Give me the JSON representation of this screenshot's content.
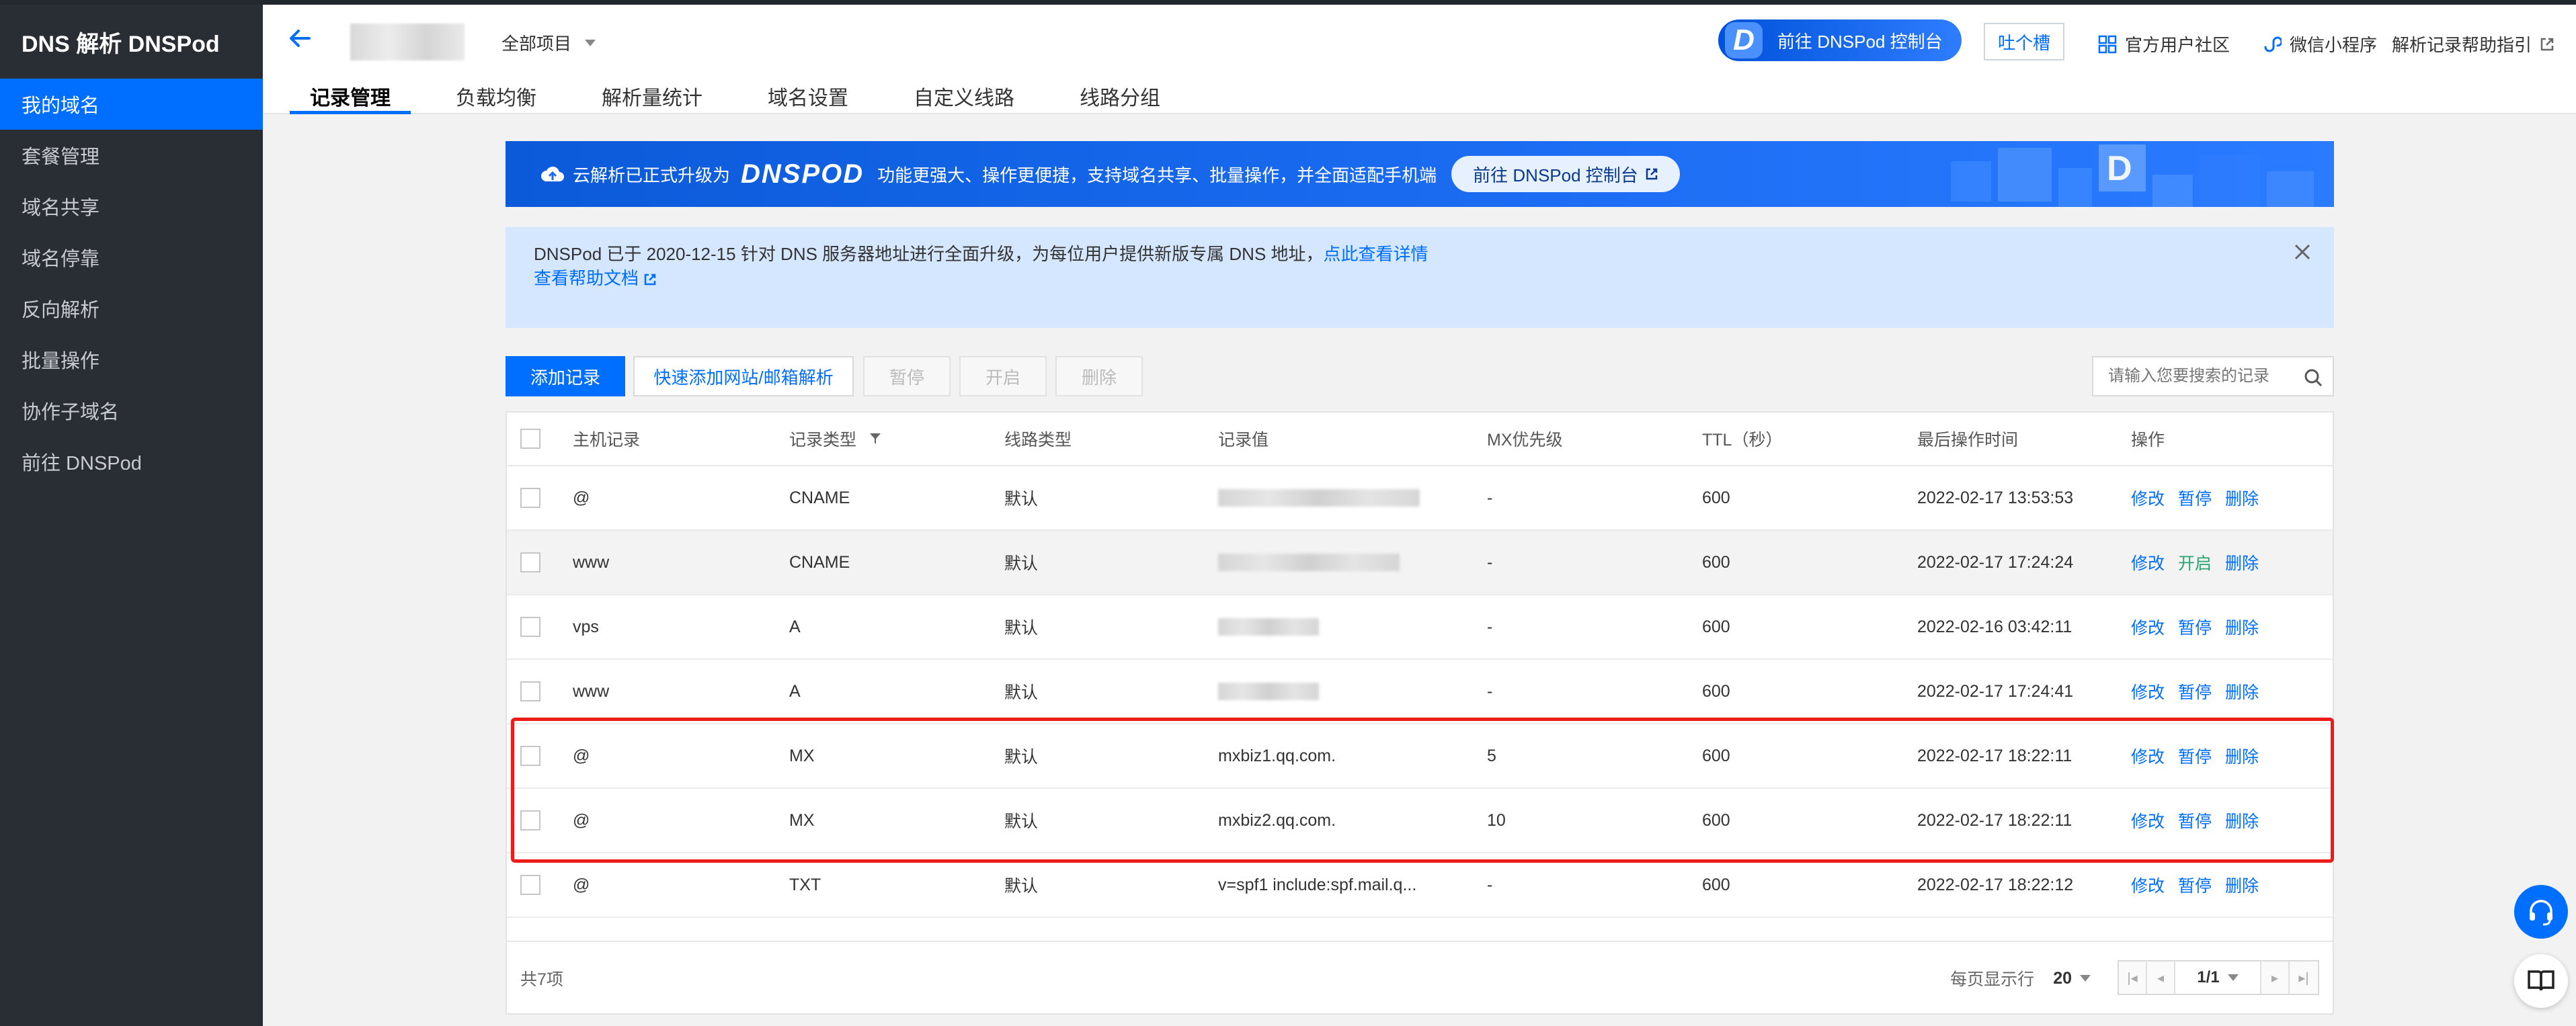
{
  "app": {
    "title": "DNS 解析 DNSPod"
  },
  "sidebar": {
    "items": [
      {
        "label": "我的域名",
        "active": true
      },
      {
        "label": "套餐管理"
      },
      {
        "label": "域名共享"
      },
      {
        "label": "域名停靠"
      },
      {
        "label": "反向解析"
      },
      {
        "label": "批量操作"
      },
      {
        "label": "协作子域名"
      },
      {
        "label": "前往 DNSPod"
      }
    ]
  },
  "header": {
    "project": "全部项目",
    "dnspod_button": "前往 DNSPod 控制台",
    "feedback": "吐个槽",
    "community": "官方用户社区",
    "miniprogram": "微信小程序",
    "help": "解析记录帮助指引",
    "tabs": [
      {
        "label": "记录管理",
        "active": true
      },
      {
        "label": "负载均衡"
      },
      {
        "label": "解析量统计"
      },
      {
        "label": "域名设置"
      },
      {
        "label": "自定义线路"
      },
      {
        "label": "线路分组"
      }
    ]
  },
  "banner": {
    "prefix": "云解析已正式升级为",
    "brand": "DNSPOD",
    "text": "功能更强大、操作更便捷，支持域名共享、批量操作，并全面适配手机端",
    "button": "前往 DNSPod 控制台"
  },
  "notice": {
    "text": "DNSPod 已于 2020-12-15 针对 DNS 服务器地址进行全面升级，为每位用户提供新版专属 DNS 地址，",
    "link": "点此查看详情",
    "doc_link": "查看帮助文档"
  },
  "toolbar": {
    "add": "添加记录",
    "quick_add": "快速添加网站/邮箱解析",
    "pause": "暂停",
    "enable": "开启",
    "delete": "删除",
    "search_placeholder": "请输入您要搜索的记录"
  },
  "table": {
    "headers": {
      "host": "主机记录",
      "type": "记录类型",
      "line": "线路类型",
      "value": "记录值",
      "mx": "MX优先级",
      "ttl": "TTL（秒）",
      "time": "最后操作时间",
      "ops": "操作"
    },
    "rows": [
      {
        "host": "@",
        "type": "CNAME",
        "line": "默认",
        "value": "",
        "mx": "-",
        "ttl": "600",
        "time": "2022-02-17 13:53:53",
        "op1": "修改",
        "op2": "暂停",
        "op3": "删除"
      },
      {
        "host": "www",
        "type": "CNAME",
        "line": "默认",
        "value": "",
        "mx": "-",
        "ttl": "600",
        "time": "2022-02-17 17:24:24",
        "op1": "修改",
        "op2": "开启",
        "op3": "删除"
      },
      {
        "host": "vps",
        "type": "A",
        "line": "默认",
        "value": "",
        "mx": "-",
        "ttl": "600",
        "time": "2022-02-16 03:42:11",
        "op1": "修改",
        "op2": "暂停",
        "op3": "删除"
      },
      {
        "host": "www",
        "type": "A",
        "line": "默认",
        "value": "",
        "mx": "-",
        "ttl": "600",
        "time": "2022-02-17 17:24:41",
        "op1": "修改",
        "op2": "暂停",
        "op3": "删除"
      },
      {
        "host": "@",
        "type": "MX",
        "line": "默认",
        "value": "mxbiz1.qq.com.",
        "mx": "5",
        "ttl": "600",
        "time": "2022-02-17 18:22:11",
        "op1": "修改",
        "op2": "暂停",
        "op3": "删除"
      },
      {
        "host": "@",
        "type": "MX",
        "line": "默认",
        "value": "mxbiz2.qq.com.",
        "mx": "10",
        "ttl": "600",
        "time": "2022-02-17 18:22:11",
        "op1": "修改",
        "op2": "暂停",
        "op3": "删除"
      },
      {
        "host": "@",
        "type": "TXT",
        "line": "默认",
        "value": "v=spf1 include:spf.mail.q...",
        "mx": "-",
        "ttl": "600",
        "time": "2022-02-17 18:22:12",
        "op1": "修改",
        "op2": "暂停",
        "op3": "删除"
      }
    ],
    "total": "共7项",
    "per_page_label": "每页显示行",
    "per_page": "20",
    "page": "1/1"
  }
}
